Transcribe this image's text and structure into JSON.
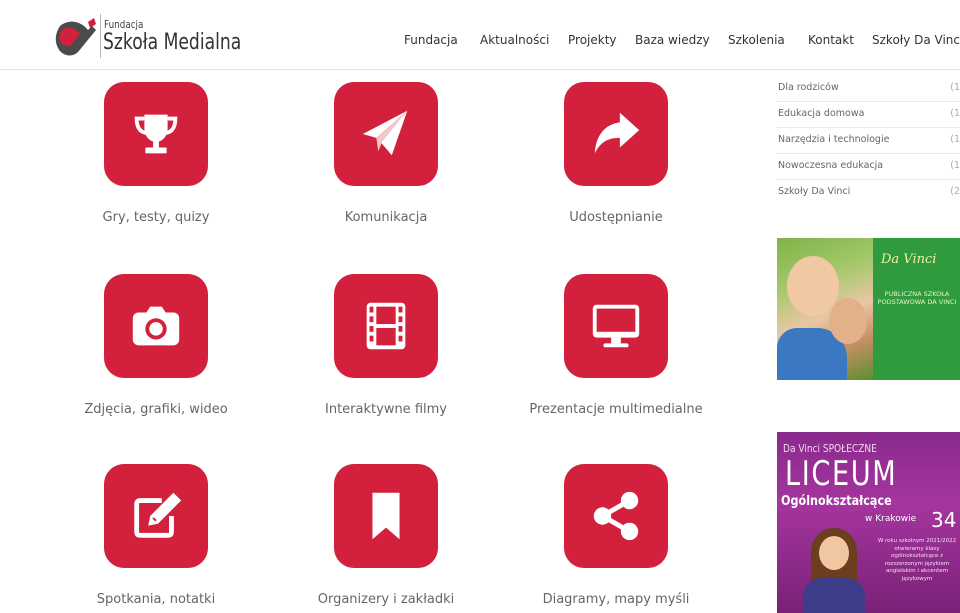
{
  "brand": {
    "line1": "Fundacja",
    "line2": "Szkoła Medialna",
    "colors": {
      "accent": "#d3203c",
      "logo_gray": "#4b4b4b"
    }
  },
  "nav": {
    "items": [
      {
        "label": "Fundacja"
      },
      {
        "label": "Aktualności"
      },
      {
        "label": "Projekty"
      },
      {
        "label": "Baza wiedzy"
      },
      {
        "label": "Szkolenia"
      },
      {
        "label": "Kontakt"
      },
      {
        "label": "Szkoły Da Vinci"
      }
    ]
  },
  "tiles": [
    {
      "label": "Gry, testy, quizy",
      "icon": "trophy-icon"
    },
    {
      "label": "Komunikacja",
      "icon": "paper-plane-icon"
    },
    {
      "label": "Udostępnianie",
      "icon": "share-arrow-icon"
    },
    {
      "label": "Zdjęcia, grafiki, wideo",
      "icon": "camera-icon"
    },
    {
      "label": "Interaktywne filmy",
      "icon": "film-icon"
    },
    {
      "label": "Prezentacje multimedialne",
      "icon": "monitor-icon"
    },
    {
      "label": "Spotkania, notatki",
      "icon": "edit-icon"
    },
    {
      "label": "Organizery i zakładki",
      "icon": "bookmark-icon"
    },
    {
      "label": "Diagramy, mapy myśli",
      "icon": "share-nodes-icon"
    }
  ],
  "sidebar": {
    "categories": [
      {
        "label": "Dla rodziców",
        "count": "(1"
      },
      {
        "label": "Edukacja domowa",
        "count": "(1"
      },
      {
        "label": "Narzędzia i technologie",
        "count": "(1"
      },
      {
        "label": "Nowoczesna edukacja",
        "count": "(1"
      },
      {
        "label": "Szkoły Da Vinci",
        "count": "(2"
      }
    ],
    "banner1": {
      "logo": "Da Vinci",
      "text": "PUBLICZNA SZKOŁA PODSTAWOWA DA VINCI"
    },
    "banner2": {
      "top": "Da Vinci SPOŁECZNE",
      "big": "LICEUM",
      "sub": "Ogólnokształcące",
      "city": "w Krakowie",
      "number": "34",
      "text": "W roku szkolnym 2021/2022 otwieramy klasy ogólnokształcące z rozszerzonym językiem angielskim i akcentem językowym"
    }
  }
}
